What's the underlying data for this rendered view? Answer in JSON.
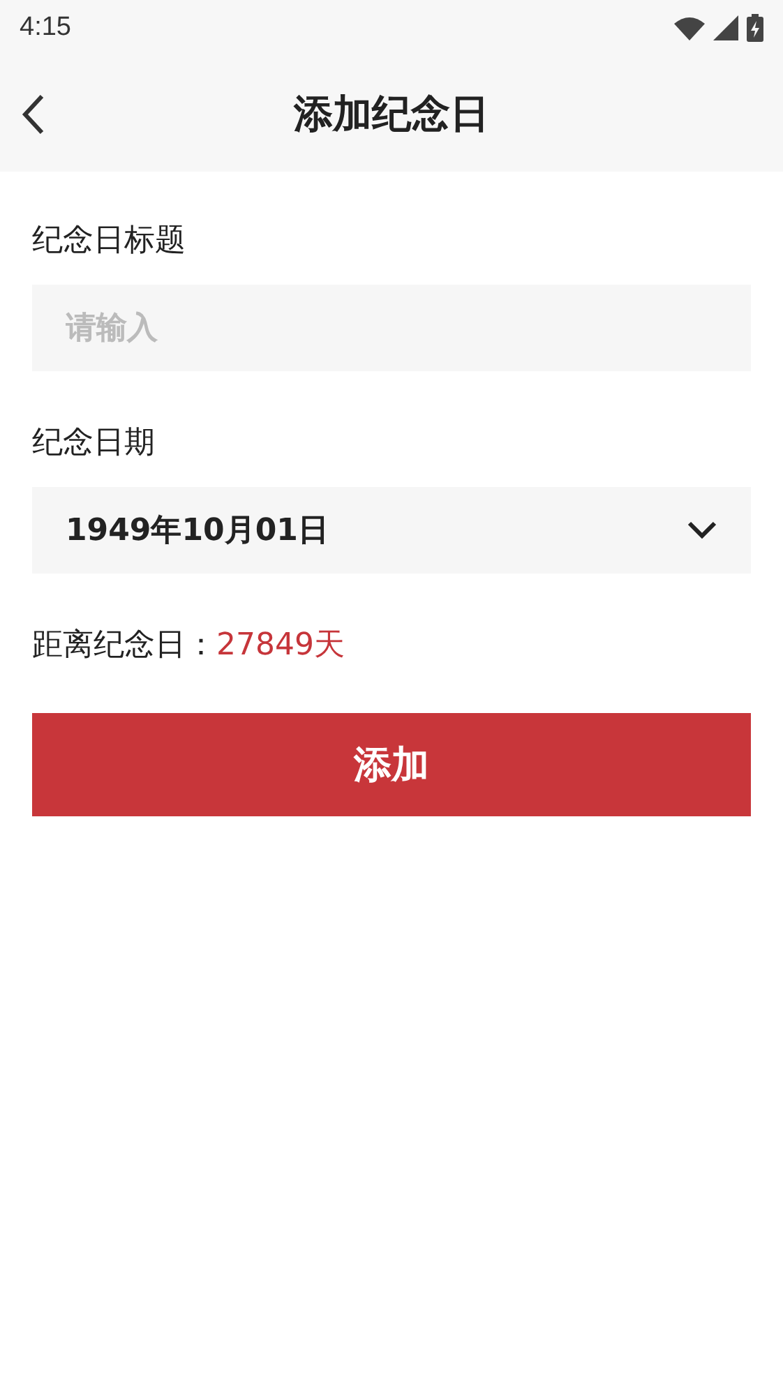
{
  "status_bar": {
    "time": "4:15"
  },
  "header": {
    "title": "添加纪念日"
  },
  "form": {
    "title_label": "纪念日标题",
    "title_field": {
      "placeholder": "请输入"
    },
    "date_label": "纪念日期",
    "date_field": {
      "value": "1949年10月01日"
    },
    "distance_label": "距离纪念日：",
    "distance_value": "27849天"
  },
  "submit_button": {
    "label": "添加"
  }
}
